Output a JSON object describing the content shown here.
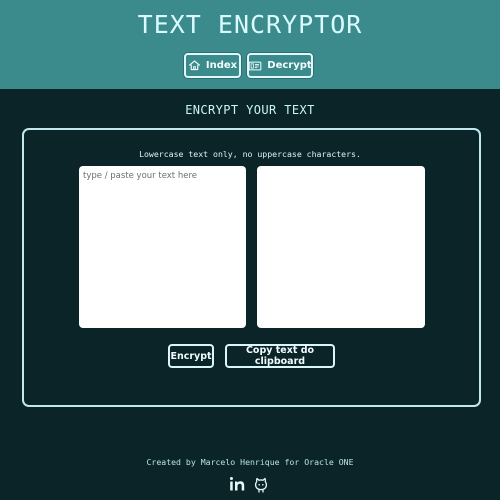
{
  "app": {
    "title": "TEXT ENCRYPTOR"
  },
  "nav": {
    "index_label": "Index",
    "decrypt_label": "Decrypt"
  },
  "main": {
    "section_title": "ENCRYPT YOUR TEXT",
    "note": "Lowercase text only, no uppercase characters.",
    "input": {
      "placeholder": "type / paste your text here",
      "value": ""
    },
    "output": {
      "value": ""
    },
    "encrypt_label": "Encrypt",
    "copy_label": "Copy text do clipboard"
  },
  "footer": {
    "credit": "Created by Marcelo Henrique for Oracle ONE",
    "icons": [
      "linkedin-icon",
      "github-icon"
    ]
  },
  "colors": {
    "header_bg": "#3b8b8d",
    "page_bg": "#0b2428",
    "text": "#c6f3f6"
  }
}
